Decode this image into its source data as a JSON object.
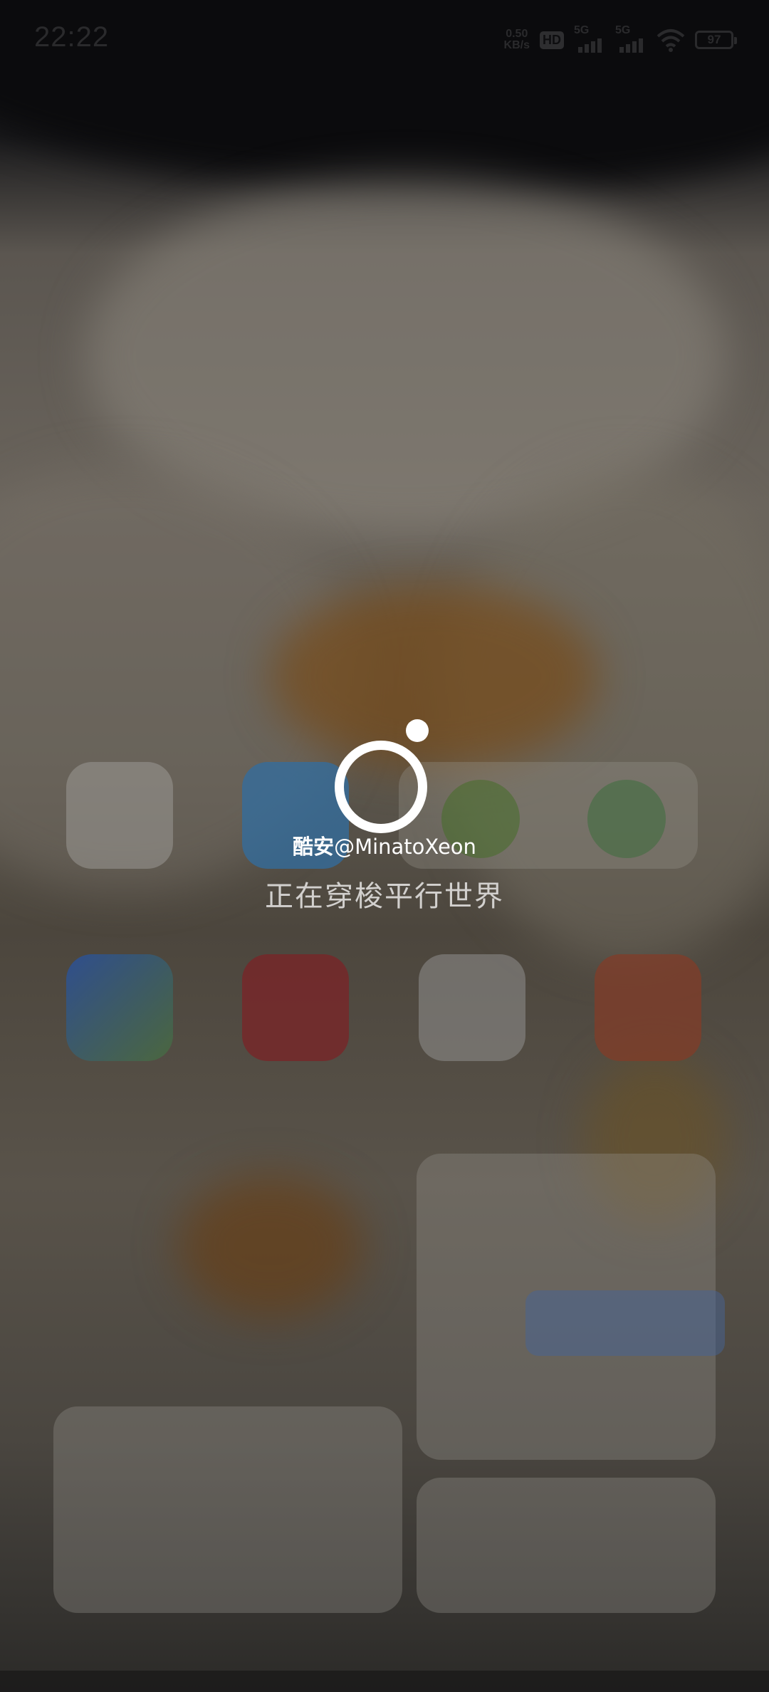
{
  "status_bar": {
    "time": "22:22",
    "net_speed_value": "0.50",
    "net_speed_unit": "KB/s",
    "hd_label": "HD",
    "sim1_label": "5G",
    "sim2_label": "5G",
    "battery_level": "97"
  },
  "splash": {
    "brand_cn": "酷安",
    "brand_handle": "@MinatoXeon",
    "loading_message": "正在穿梭平行世界"
  },
  "colors": {
    "overlay_text": "#ffffff",
    "loading_text": "#d2d0ce"
  }
}
